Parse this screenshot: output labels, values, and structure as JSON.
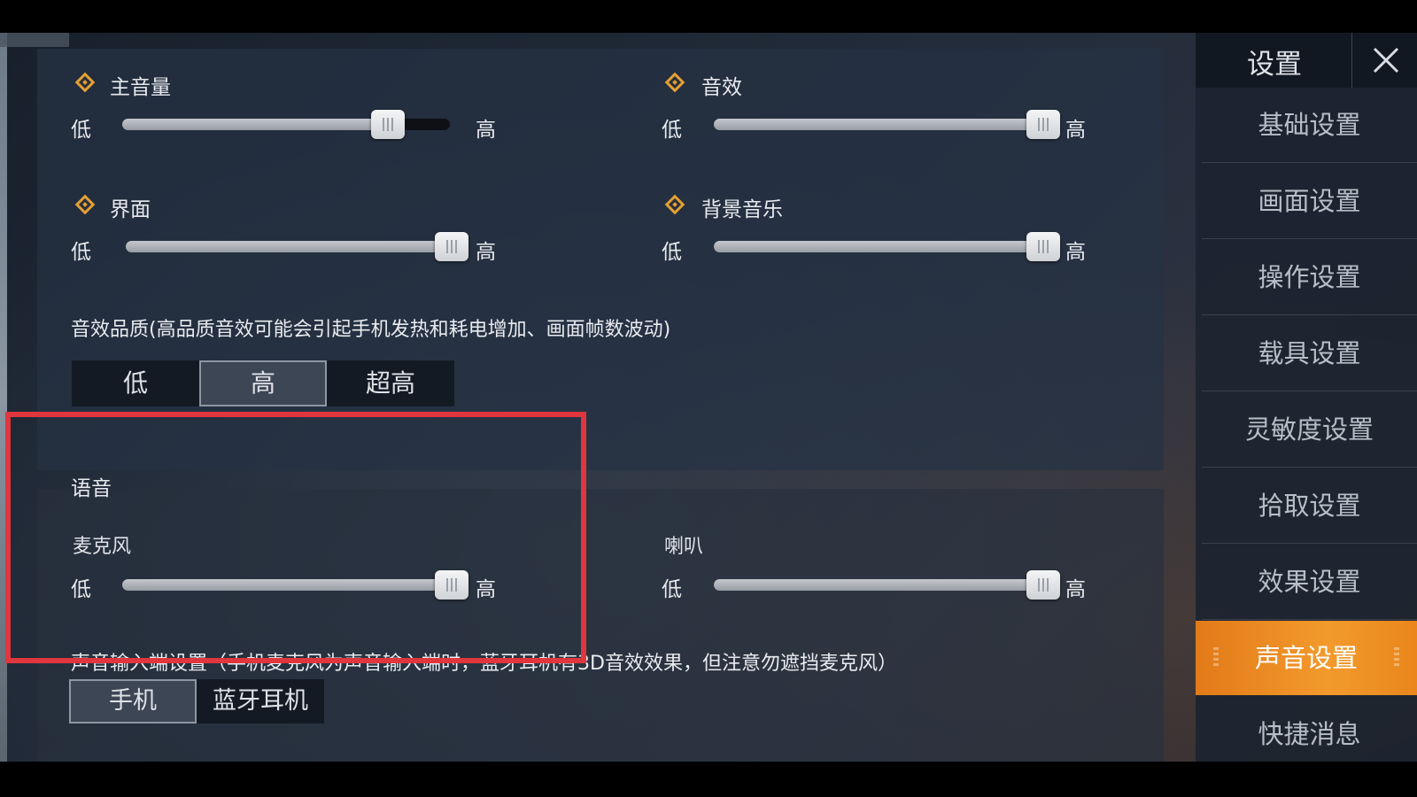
{
  "sidebar": {
    "title": "设置",
    "items": [
      {
        "label": "基础设置",
        "active": false
      },
      {
        "label": "画面设置",
        "active": false
      },
      {
        "label": "操作设置",
        "active": false
      },
      {
        "label": "载具设置",
        "active": false
      },
      {
        "label": "灵敏度设置",
        "active": false
      },
      {
        "label": "拾取设置",
        "active": false
      },
      {
        "label": "效果设置",
        "active": false
      },
      {
        "label": "声音设置",
        "active": true
      },
      {
        "label": "快捷消息",
        "active": false
      }
    ]
  },
  "volume": {
    "low_label": "低",
    "high_label": "高",
    "sliders": [
      {
        "title": "主音量",
        "value": 0.81
      },
      {
        "title": "音效",
        "value": 1.0
      },
      {
        "title": "界面",
        "value": 1.0
      },
      {
        "title": "背景音乐",
        "value": 1.0
      }
    ]
  },
  "sound_quality": {
    "title": "音效品质(高品质音效可能会引起手机发热和耗电增加、画面帧数波动)",
    "options": [
      "低",
      "高",
      "超高"
    ],
    "selected": "高"
  },
  "voice": {
    "section_title": "语音",
    "mic": {
      "title": "麦克风",
      "value": 1.0
    },
    "speaker": {
      "title": "喇叭",
      "value": 1.0
    },
    "input_note": "声音输入端设置（手机麦克风为声音输入端时，蓝牙耳机有3D音效效果，但注意勿遮挡麦克风）",
    "input_options": [
      "手机",
      "蓝牙耳机"
    ],
    "input_selected": "手机"
  },
  "colors": {
    "accent_orange": "#f39a2c",
    "highlight_red": "#e0363e",
    "diamond_icon": "#e3a034"
  },
  "icons": {
    "close": "close-icon",
    "diamond": "diamond-icon",
    "slider_thumb": "slider-grip-icon"
  }
}
